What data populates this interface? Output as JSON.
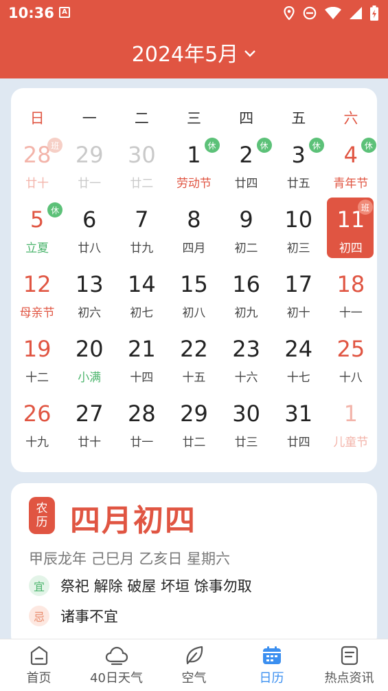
{
  "status_bar": {
    "time": "10:36",
    "notification_icon": "A",
    "icons": [
      "location-icon",
      "dnd-icon",
      "wifi-icon",
      "signal-icon",
      "battery-icon"
    ]
  },
  "header": {
    "title": "2024年5月"
  },
  "calendar": {
    "weekdays": [
      "日",
      "一",
      "二",
      "三",
      "四",
      "五",
      "六"
    ],
    "weeks": [
      [
        {
          "day": "28",
          "lunar": "廿十",
          "type": "other",
          "badge": "班"
        },
        {
          "day": "29",
          "lunar": "廿一",
          "type": "other"
        },
        {
          "day": "30",
          "lunar": "廿二",
          "type": "other"
        },
        {
          "day": "1",
          "lunar": "劳动节",
          "type": "holiday",
          "badge": "休"
        },
        {
          "day": "2",
          "lunar": "廿四",
          "badge": "休"
        },
        {
          "day": "3",
          "lunar": "廿五",
          "badge": "休"
        },
        {
          "day": "4",
          "lunar": "青年节",
          "type": "holiday",
          "badge": "休"
        }
      ],
      [
        {
          "day": "5",
          "lunar": "立夏",
          "type": "solar",
          "badge": "休"
        },
        {
          "day": "6",
          "lunar": "廿八"
        },
        {
          "day": "7",
          "lunar": "廿九"
        },
        {
          "day": "8",
          "lunar": "四月"
        },
        {
          "day": "9",
          "lunar": "初二"
        },
        {
          "day": "10",
          "lunar": "初三"
        },
        {
          "day": "11",
          "lunar": "初四",
          "type": "selected",
          "badge": "班"
        }
      ],
      [
        {
          "day": "12",
          "lunar": "母亲节",
          "type": "holiday"
        },
        {
          "day": "13",
          "lunar": "初六"
        },
        {
          "day": "14",
          "lunar": "初七"
        },
        {
          "day": "15",
          "lunar": "初八"
        },
        {
          "day": "16",
          "lunar": "初九"
        },
        {
          "day": "17",
          "lunar": "初十"
        },
        {
          "day": "18",
          "lunar": "十一"
        }
      ],
      [
        {
          "day": "19",
          "lunar": "十二"
        },
        {
          "day": "20",
          "lunar": "小满",
          "type": "solar"
        },
        {
          "day": "21",
          "lunar": "十四"
        },
        {
          "day": "22",
          "lunar": "十五"
        },
        {
          "day": "23",
          "lunar": "十六"
        },
        {
          "day": "24",
          "lunar": "十七"
        },
        {
          "day": "25",
          "lunar": "十八"
        }
      ],
      [
        {
          "day": "26",
          "lunar": "十九"
        },
        {
          "day": "27",
          "lunar": "廿十"
        },
        {
          "day": "28",
          "lunar": "廿一"
        },
        {
          "day": "29",
          "lunar": "廿二"
        },
        {
          "day": "30",
          "lunar": "廿三"
        },
        {
          "day": "31",
          "lunar": "廿四"
        },
        {
          "day": "1",
          "lunar": "儿童节",
          "type": "other"
        }
      ]
    ]
  },
  "lunar_card": {
    "seal_top": "农",
    "seal_bottom": "历",
    "date": "四月初四",
    "ganzhi": "甲辰龙年 己巳月 乙亥日 星期六",
    "yi_label": "宜",
    "yi_text": "祭祀 解除 破屋 坏垣 馀事勿取",
    "ji_label": "忌",
    "ji_text": "诸事不宜"
  },
  "nav": [
    {
      "label": "首页",
      "icon": "home-icon"
    },
    {
      "label": "40日天气",
      "icon": "cloud-icon"
    },
    {
      "label": "空气",
      "icon": "leaf-icon"
    },
    {
      "label": "日历",
      "icon": "calendar-icon",
      "active": true
    },
    {
      "label": "热点资讯",
      "icon": "news-icon"
    }
  ],
  "colors": {
    "accent": "#e05542",
    "rest_badge": "#5cc178",
    "solar_term": "#4cb56d",
    "nav_active": "#3b8ff0"
  }
}
